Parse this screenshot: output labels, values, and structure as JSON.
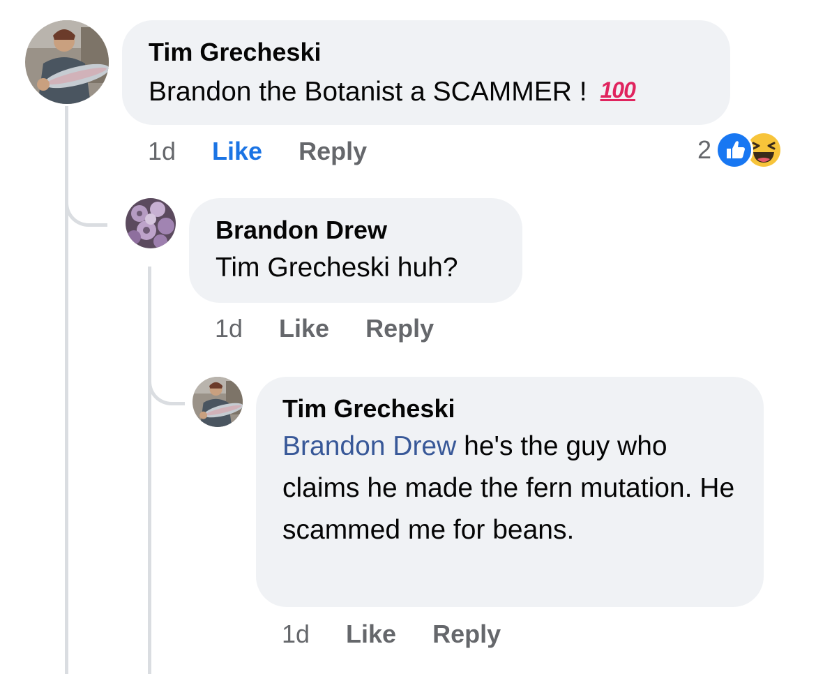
{
  "comments": [
    {
      "author": "Tim Grecheski",
      "text": "Brandon the Botanist a SCAMMER !",
      "emoji": "100",
      "time": "1d",
      "like_label": "Like",
      "reply_label": "Reply",
      "reaction_count": "2",
      "reaction_icons": [
        "like-reaction-icon",
        "haha-reaction-icon"
      ]
    },
    {
      "author": "Brandon Drew",
      "text": "Tim Grecheski huh?",
      "time": "1d",
      "like_label": "Like",
      "reply_label": "Reply"
    },
    {
      "author": "Tim Grecheski",
      "mention": "Brandon Drew",
      "text": " he's the guy who claims he made the fern mutation. He scammed me for beans.",
      "time": "1d",
      "like_label": "Like",
      "reply_label": "Reply"
    }
  ],
  "colors": {
    "bubble": "#f0f2f5",
    "link_blue": "#1b74e4",
    "mention": "#385898",
    "muted": "#65676b",
    "thread_line": "#dadde1"
  }
}
